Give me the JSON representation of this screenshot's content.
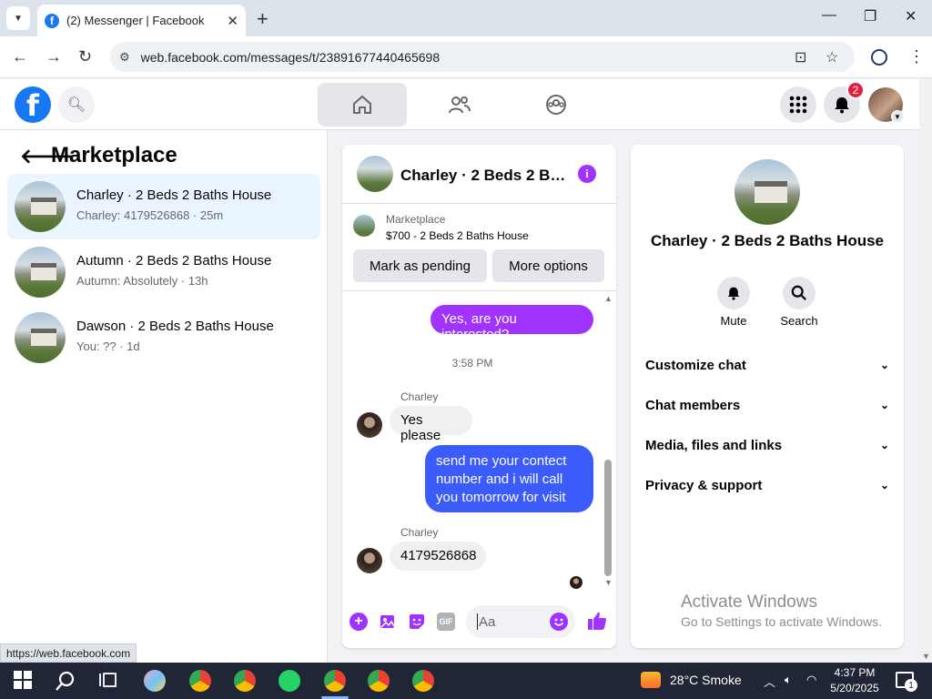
{
  "browser": {
    "tab_title": "(2) Messenger | Facebook",
    "url": "web.facebook.com/messages/t/23891677440465698",
    "status_url": "https://web.facebook.com"
  },
  "fb": {
    "notification_count": "2"
  },
  "left": {
    "title": "Marketplace",
    "conversations": [
      {
        "name": "Charley · 2 Beds 2 Baths House",
        "preview": "Charley: 4179526868 · 25m",
        "active": true
      },
      {
        "name": "Autumn · 2 Beds 2 Baths House",
        "preview": "Autumn: Absolutely · 13h",
        "active": false
      },
      {
        "name": "Dawson · 2 Beds 2 Baths House",
        "preview": "You: ?? · 1d",
        "active": false
      }
    ]
  },
  "chat": {
    "title": "Charley · 2 Beds 2 Ba...",
    "listing_label": "Marketplace",
    "listing_price": "$700 - 2 Beds 2 Baths House",
    "mark_pending": "Mark as pending",
    "more_options": "More options",
    "messages": {
      "out1": "Yes, are you interested?",
      "timestamp": "3:58 PM",
      "sender1": "Charley",
      "in1": "Yes please",
      "out2_lines": [
        "send me your contect",
        "number and i will call",
        "you tomorrow for visit"
      ],
      "sender2": "Charley",
      "in2": "4179526868"
    },
    "input_placeholder": "Aa"
  },
  "right": {
    "title": "Charley · 2 Beds 2 Baths House",
    "mute_label": "Mute",
    "search_label": "Search",
    "sections": [
      "Customize chat",
      "Chat members",
      "Media, files and links",
      "Privacy & support"
    ],
    "activate_line1": "Activate Windows",
    "activate_line2": "Go to Settings to activate Windows."
  },
  "taskbar": {
    "weather": "28°C  Smoke",
    "time": "4:37 PM",
    "date": "5/20/2025",
    "notif_count": "1"
  },
  "colors": {
    "accent": "#a033ff",
    "fb_blue": "#1877f2",
    "taskbar": "#202635"
  }
}
